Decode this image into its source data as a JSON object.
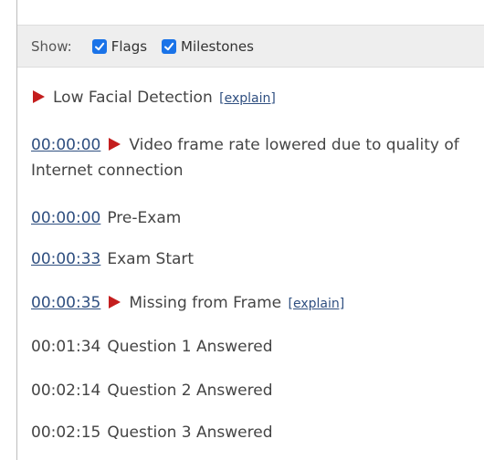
{
  "filters": {
    "show_label": "Show:",
    "options": [
      {
        "label": "Flags",
        "checked": true
      },
      {
        "label": "Milestones",
        "checked": true
      }
    ],
    "checkbox_color": "#1a73e8"
  },
  "flag_color": "#c41e1e",
  "explain_label": "[explain]",
  "events": [
    {
      "time": "",
      "text": "Low Facial Detection",
      "flag": true,
      "explain": true,
      "linked": false
    },
    {
      "time": "00:00:00",
      "text": "Video frame rate lowered due to quality of Internet connection",
      "flag": true,
      "explain": false,
      "linked": true
    },
    {
      "time": "00:00:00",
      "text": "Pre-Exam",
      "flag": false,
      "explain": false,
      "linked": true
    },
    {
      "time": "00:00:33",
      "text": "Exam Start",
      "flag": false,
      "explain": false,
      "linked": true
    },
    {
      "time": "00:00:35",
      "text": "Missing from Frame",
      "flag": true,
      "explain": true,
      "linked": true
    },
    {
      "time": "00:01:34",
      "text": "Question 1 Answered",
      "flag": false,
      "explain": false,
      "linked": false
    },
    {
      "time": "00:02:14",
      "text": "Question 2 Answered",
      "flag": false,
      "explain": false,
      "linked": false
    },
    {
      "time": "00:02:15",
      "text": "Question 3 Answered",
      "flag": false,
      "explain": false,
      "linked": false
    }
  ]
}
